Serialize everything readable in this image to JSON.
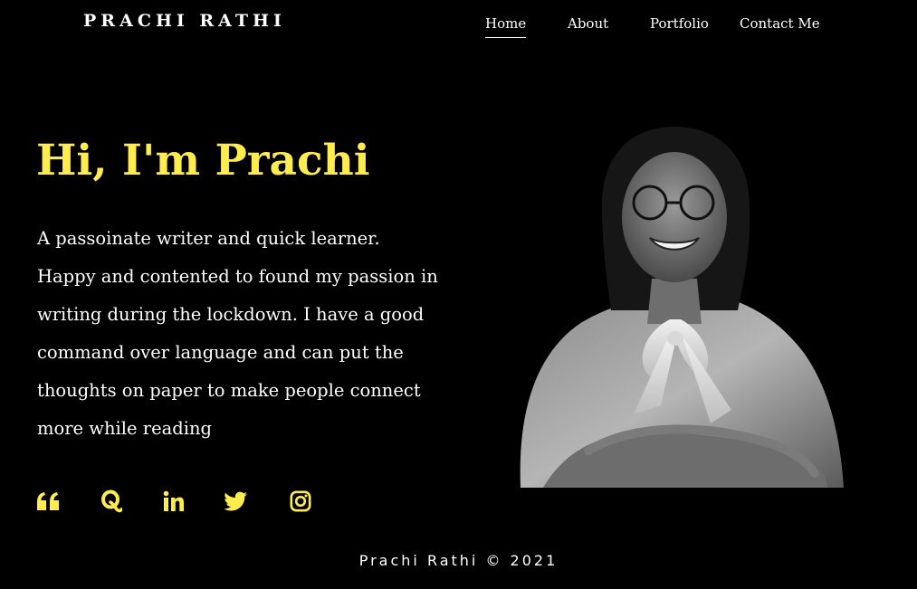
{
  "header": {
    "brand": "PRACHI RATHI",
    "nav": [
      {
        "label": "Home",
        "active": true
      },
      {
        "label": "About",
        "active": false
      },
      {
        "label": "Portfolio",
        "active": false
      },
      {
        "label": "Contact Me",
        "active": false
      }
    ]
  },
  "hero": {
    "title": "Hi, I'm Prachi",
    "lines": [
      "A passoinate writer and quick learner.",
      "Happy and contented to found my passion in writing during the lockdown. I have a good command over language and can put the thoughts on paper to make people connect more while reading"
    ]
  },
  "socials": [
    {
      "name": "quote-icon"
    },
    {
      "name": "quora-icon"
    },
    {
      "name": "linkedin-icon"
    },
    {
      "name": "twitter-icon"
    },
    {
      "name": "instagram-icon"
    }
  ],
  "footer": {
    "text": "Prachi Rathi © 2021"
  },
  "colors": {
    "background": "#000000",
    "accent": "#ffed4f",
    "text": "#ffffff"
  }
}
